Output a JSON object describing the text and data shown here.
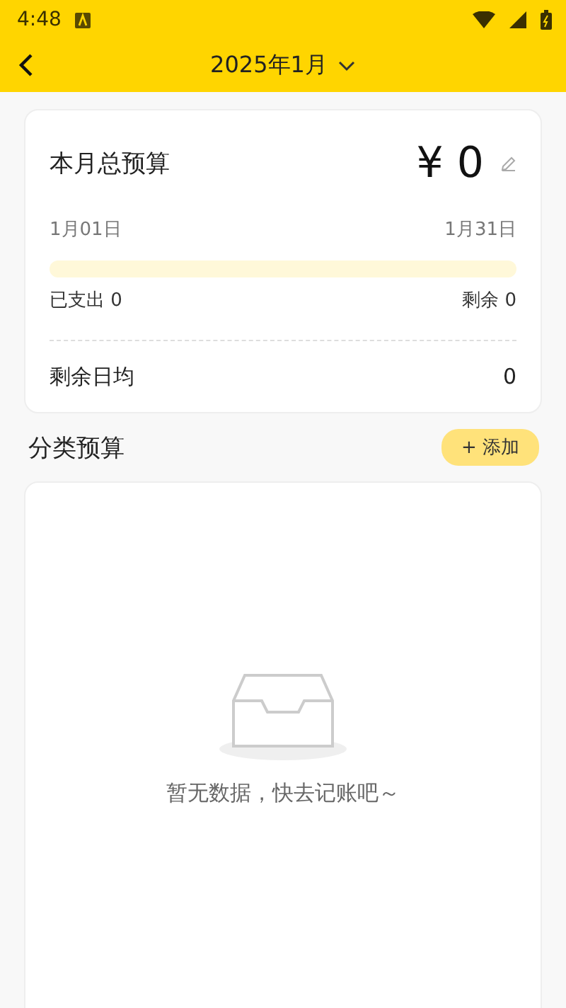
{
  "status_bar": {
    "time": "4:48"
  },
  "header": {
    "title": "2025年1月"
  },
  "budget_card": {
    "title": "本月总预算",
    "currency": "¥",
    "amount": "0",
    "start_date": "1月01日",
    "end_date": "1月31日",
    "progress": {
      "level": 0
    },
    "spent": "已支出 0",
    "remaining": "剩余 0",
    "daily_label": "剩余日均",
    "daily_value": "0"
  },
  "category_budget": {
    "title": "分类预算",
    "add_button": "+ 添加",
    "empty_message": "暂无数据，快去记账吧～"
  }
}
